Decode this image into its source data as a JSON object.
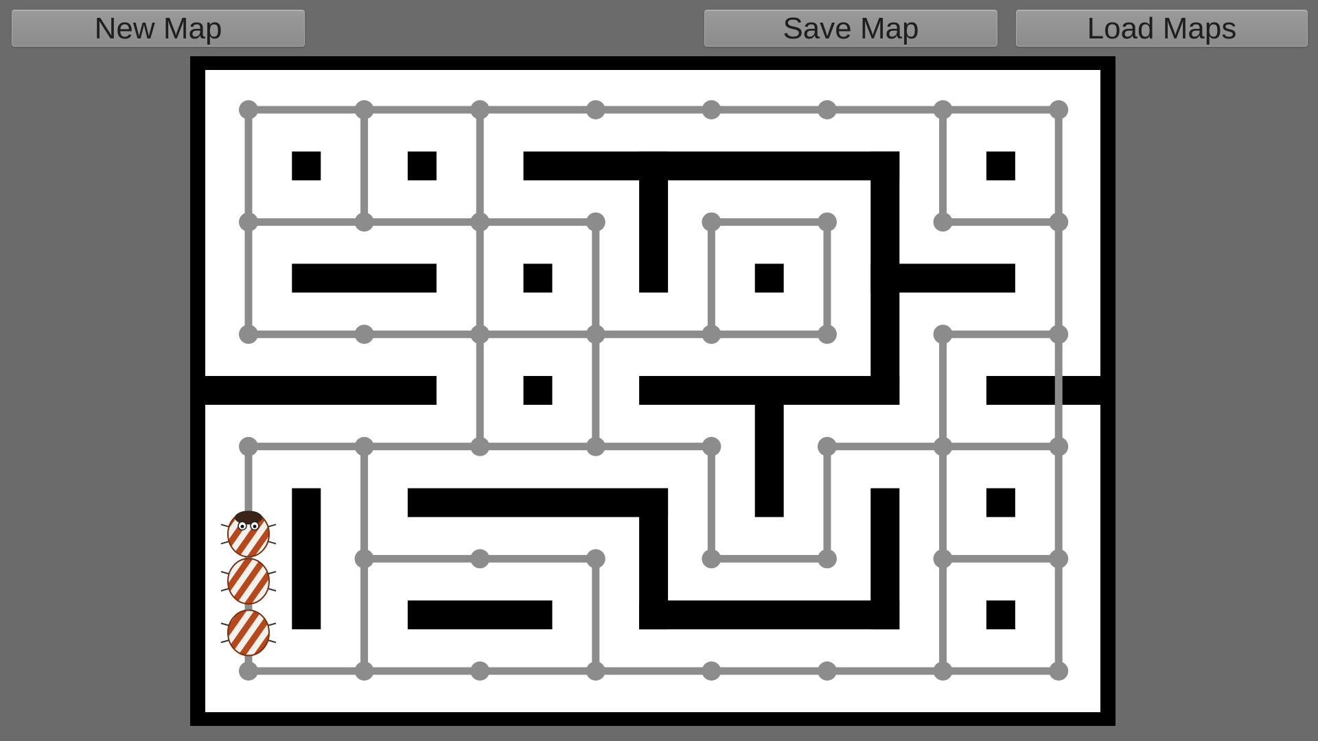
{
  "toolbar": {
    "new_label": "New Map",
    "save_label": "Save Map",
    "load_label": "Load Maps"
  },
  "colors": {
    "background": "#6b6b6b",
    "maze_floor": "#ffffff",
    "wall": "#000000",
    "path": "#8c8c8c",
    "button": "#909090",
    "snake_stripe": "#b5481c"
  },
  "maze": {
    "columns": 8,
    "rows": 6,
    "path_nodes": [
      [
        0,
        0
      ],
      [
        1,
        0
      ],
      [
        2,
        0
      ],
      [
        3,
        0
      ],
      [
        4,
        0
      ],
      [
        5,
        0
      ],
      [
        6,
        0
      ],
      [
        7,
        0
      ],
      [
        0,
        1
      ],
      [
        1,
        1
      ],
      [
        2,
        1
      ],
      [
        3,
        1
      ],
      [
        4,
        1
      ],
      [
        5,
        1
      ],
      [
        6,
        1
      ],
      [
        7,
        1
      ],
      [
        0,
        2
      ],
      [
        1,
        2
      ],
      [
        2,
        2
      ],
      [
        3,
        2
      ],
      [
        4,
        2
      ],
      [
        5,
        2
      ],
      [
        6,
        2
      ],
      [
        7,
        2
      ],
      [
        0,
        3
      ],
      [
        1,
        3
      ],
      [
        2,
        3
      ],
      [
        3,
        3
      ],
      [
        4,
        3
      ],
      [
        5,
        3
      ],
      [
        6,
        3
      ],
      [
        7,
        3
      ],
      [
        1,
        4
      ],
      [
        2,
        4
      ],
      [
        3,
        4
      ],
      [
        4,
        4
      ],
      [
        5,
        4
      ],
      [
        6,
        4
      ],
      [
        7,
        4
      ],
      [
        0,
        5
      ],
      [
        1,
        5
      ],
      [
        2,
        5
      ],
      [
        3,
        5
      ],
      [
        4,
        5
      ],
      [
        5,
        5
      ],
      [
        6,
        5
      ],
      [
        7,
        5
      ]
    ],
    "path_edges": [
      [
        [
          0,
          0
        ],
        [
          7,
          0
        ]
      ],
      [
        [
          0,
          1
        ],
        [
          3,
          1
        ]
      ],
      [
        [
          4,
          1
        ],
        [
          5,
          1
        ]
      ],
      [
        [
          6,
          1
        ],
        [
          7,
          1
        ]
      ],
      [
        [
          0,
          2
        ],
        [
          5,
          2
        ]
      ],
      [
        [
          6,
          2
        ],
        [
          7,
          2
        ]
      ],
      [
        [
          0,
          3
        ],
        [
          4,
          3
        ]
      ],
      [
        [
          5,
          3
        ],
        [
          7,
          3
        ]
      ],
      [
        [
          1,
          4
        ],
        [
          3,
          4
        ]
      ],
      [
        [
          4,
          4
        ],
        [
          5,
          4
        ]
      ],
      [
        [
          6,
          4
        ],
        [
          7,
          4
        ]
      ],
      [
        [
          0,
          5
        ],
        [
          7,
          5
        ]
      ],
      [
        [
          0,
          0
        ],
        [
          0,
          2
        ]
      ],
      [
        [
          0,
          3
        ],
        [
          0,
          5
        ]
      ],
      [
        [
          1,
          0
        ],
        [
          1,
          1
        ]
      ],
      [
        [
          1,
          3
        ],
        [
          1,
          5
        ]
      ],
      [
        [
          2,
          0
        ],
        [
          2,
          3
        ]
      ],
      [
        [
          3,
          1
        ],
        [
          3,
          3
        ]
      ],
      [
        [
          3,
          4
        ],
        [
          3,
          5
        ]
      ],
      [
        [
          4,
          1
        ],
        [
          4,
          2
        ]
      ],
      [
        [
          4,
          3
        ],
        [
          4,
          4
        ]
      ],
      [
        [
          5,
          1
        ],
        [
          5,
          2
        ]
      ],
      [
        [
          5,
          3
        ],
        [
          5,
          4
        ]
      ],
      [
        [
          6,
          0
        ],
        [
          6,
          1
        ]
      ],
      [
        [
          6,
          2
        ],
        [
          6,
          5
        ]
      ],
      [
        [
          7,
          0
        ],
        [
          7,
          5
        ]
      ]
    ],
    "walls": [
      [
        [
          -0.5,
          2.5
        ],
        [
          1.5,
          2.5
        ]
      ],
      [
        [
          3.5,
          2.5
        ],
        [
          5.5,
          2.5
        ]
      ],
      [
        [
          6.5,
          2.5
        ],
        [
          7.5,
          2.5
        ]
      ],
      [
        [
          2.5,
          0.5
        ],
        [
          5.5,
          0.5
        ]
      ],
      [
        [
          5.5,
          0.5
        ],
        [
          5.5,
          2.5
        ]
      ],
      [
        [
          3.5,
          0.5
        ],
        [
          3.5,
          1.5
        ]
      ],
      [
        [
          5.5,
          1.5
        ],
        [
          6.5,
          1.5
        ]
      ],
      [
        [
          0.5,
          1.5
        ],
        [
          1.5,
          1.5
        ]
      ],
      [
        [
          4.5,
          2.5
        ],
        [
          4.5,
          3.5
        ]
      ],
      [
        [
          1.5,
          3.5
        ],
        [
          3.5,
          3.5
        ]
      ],
      [
        [
          3.5,
          3.5
        ],
        [
          3.5,
          4.5
        ]
      ],
      [
        [
          3.5,
          4.5
        ],
        [
          5.5,
          4.5
        ]
      ],
      [
        [
          5.5,
          3.5
        ],
        [
          5.5,
          4.5
        ]
      ],
      [
        [
          0.5,
          3.5
        ],
        [
          0.5,
          4.5
        ]
      ],
      [
        [
          1.5,
          4.5
        ],
        [
          2.5,
          4.5
        ]
      ]
    ],
    "pillars": [
      [
        0.5,
        0.5
      ],
      [
        1.5,
        0.5
      ],
      [
        6.5,
        0.5
      ],
      [
        2.5,
        1.5
      ],
      [
        4.5,
        1.5
      ],
      [
        2.5,
        2.5
      ],
      [
        6.5,
        3.5
      ],
      [
        6.5,
        4.5
      ]
    ],
    "snake": {
      "direction": "up",
      "segments": [
        [
          0,
          3.78
        ],
        [
          0,
          4.2
        ],
        [
          0,
          4.66
        ]
      ]
    }
  }
}
